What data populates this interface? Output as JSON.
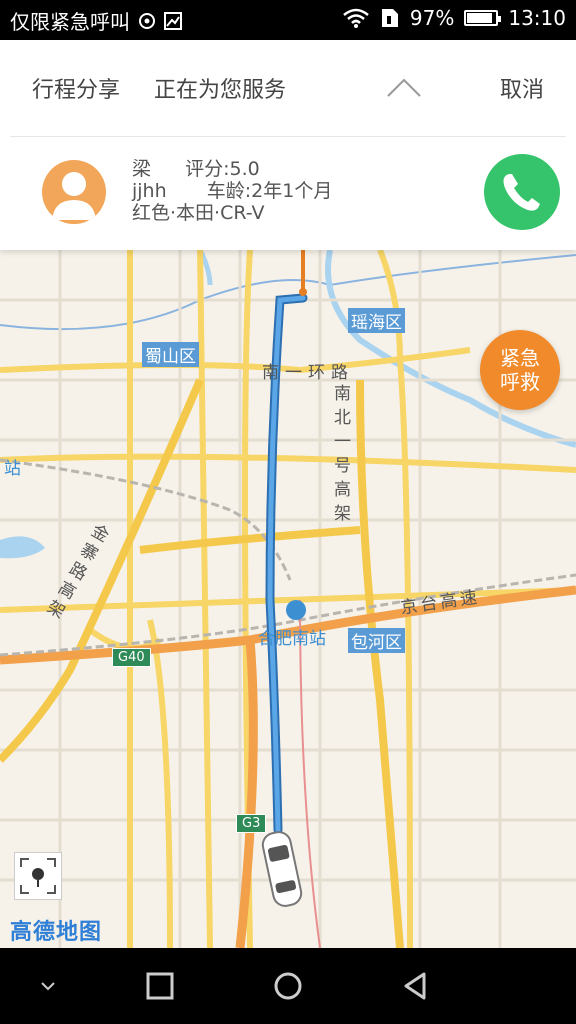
{
  "status_bar": {
    "carrier": "仅限紧急呼叫",
    "battery_percent": "97%",
    "battery_level": 0.97,
    "time": "13:10"
  },
  "trip_header": {
    "tab_share": "行程分享",
    "tab_serving": "正在为您服务",
    "cancel_label": "取消"
  },
  "driver": {
    "name": "梁",
    "rating_label": "评分:5.0",
    "plate": "jjhh",
    "car_age": "车龄:2年1个月",
    "car_desc": "红色·本田·CR-V"
  },
  "map": {
    "labels": {
      "yaohai": "瑶海区",
      "shushan": "蜀山区",
      "nanyi_ring": "南一环路",
      "nanbei": "南北一号高架",
      "jinzhai": "金寨路高架",
      "station_edge": "站",
      "hefei_south": "合肥南站",
      "baohe": "包河区",
      "jingtai": "京台高速",
      "g40": "G40",
      "g3": "G3"
    },
    "logo": "高德地图"
  },
  "emergency_button": {
    "line1": "紧急",
    "line2": "呼救"
  },
  "colors": {
    "accent_orange": "#f08a2a",
    "call_green": "#35c46b",
    "route_blue": "#3c8fd1"
  }
}
